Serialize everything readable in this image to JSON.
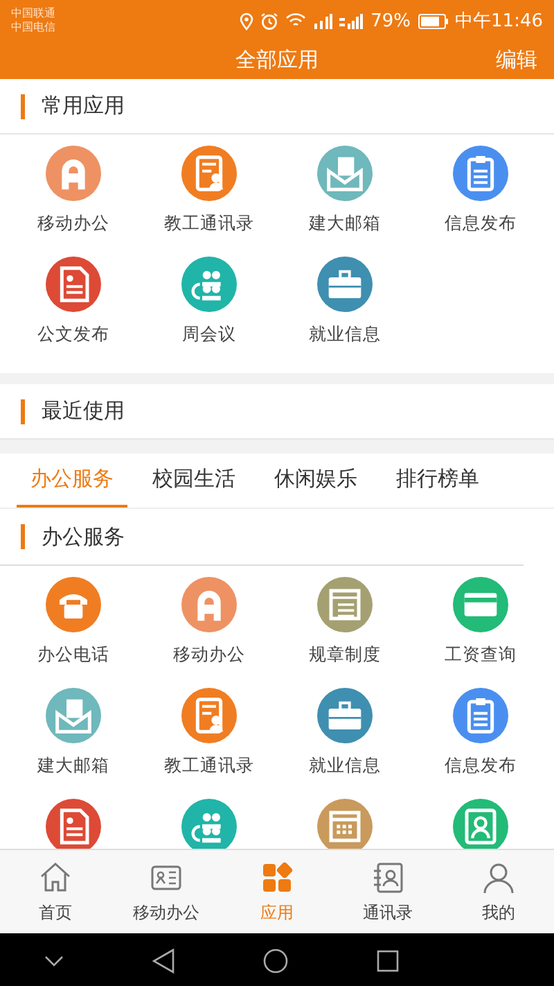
{
  "status_bar": {
    "carriers": [
      "中国联通",
      "中国电信"
    ],
    "battery": "79%",
    "time": "中午11:46"
  },
  "header": {
    "title": "全部应用",
    "action": "编辑"
  },
  "favorites": {
    "title": "常用应用",
    "apps": [
      {
        "label": "移动办公",
        "kind": "a-logo",
        "color": "#ee9263"
      },
      {
        "label": "教工通讯录",
        "kind": "contacts",
        "color": "#f07d22"
      },
      {
        "label": "建大邮箱",
        "kind": "mail",
        "color": "#6fb8bb"
      },
      {
        "label": "信息发布",
        "kind": "clipboard",
        "color": "#4a8ff0"
      },
      {
        "label": "公文发布",
        "kind": "document",
        "color": "#dd4a36"
      },
      {
        "label": "周会议",
        "kind": "meeting",
        "color": "#20b5a8"
      },
      {
        "label": "就业信息",
        "kind": "briefcase",
        "color": "#3f8fb0"
      }
    ]
  },
  "recent": {
    "title": "最近使用"
  },
  "tabs": [
    {
      "label": "办公服务",
      "selected": true
    },
    {
      "label": "校园生活",
      "selected": false
    },
    {
      "label": "休闲娱乐",
      "selected": false
    },
    {
      "label": "排行榜单",
      "selected": false
    }
  ],
  "office": {
    "title": "办公服务",
    "apps": [
      {
        "label": "办公电话",
        "kind": "phone",
        "color": "#f07d22"
      },
      {
        "label": "移动办公",
        "kind": "a-logo",
        "color": "#ee9263"
      },
      {
        "label": "规章制度",
        "kind": "rules",
        "color": "#a4a071"
      },
      {
        "label": "工资查询",
        "kind": "card",
        "color": "#22bb77"
      },
      {
        "label": "建大邮箱",
        "kind": "mail",
        "color": "#6fb8bb"
      },
      {
        "label": "教工通讯录",
        "kind": "contacts",
        "color": "#f07d22"
      },
      {
        "label": "就业信息",
        "kind": "briefcase",
        "color": "#3f8fb0"
      },
      {
        "label": "信息发布",
        "kind": "clipboard",
        "color": "#4a8ff0"
      },
      {
        "kind": "document",
        "color": "#dd4a36"
      },
      {
        "kind": "meeting",
        "color": "#20b5a8"
      },
      {
        "kind": "calendar",
        "color": "#c99a5c"
      },
      {
        "kind": "portrait",
        "color": "#22bb77"
      }
    ]
  },
  "bottom_nav": [
    {
      "label": "首页",
      "kind": "home",
      "selected": false
    },
    {
      "label": "移动办公",
      "kind": "id-card",
      "selected": false
    },
    {
      "label": "应用",
      "kind": "apps",
      "selected": true
    },
    {
      "label": "通讯录",
      "kind": "address-book",
      "selected": false
    },
    {
      "label": "我的",
      "kind": "person",
      "selected": false
    }
  ]
}
